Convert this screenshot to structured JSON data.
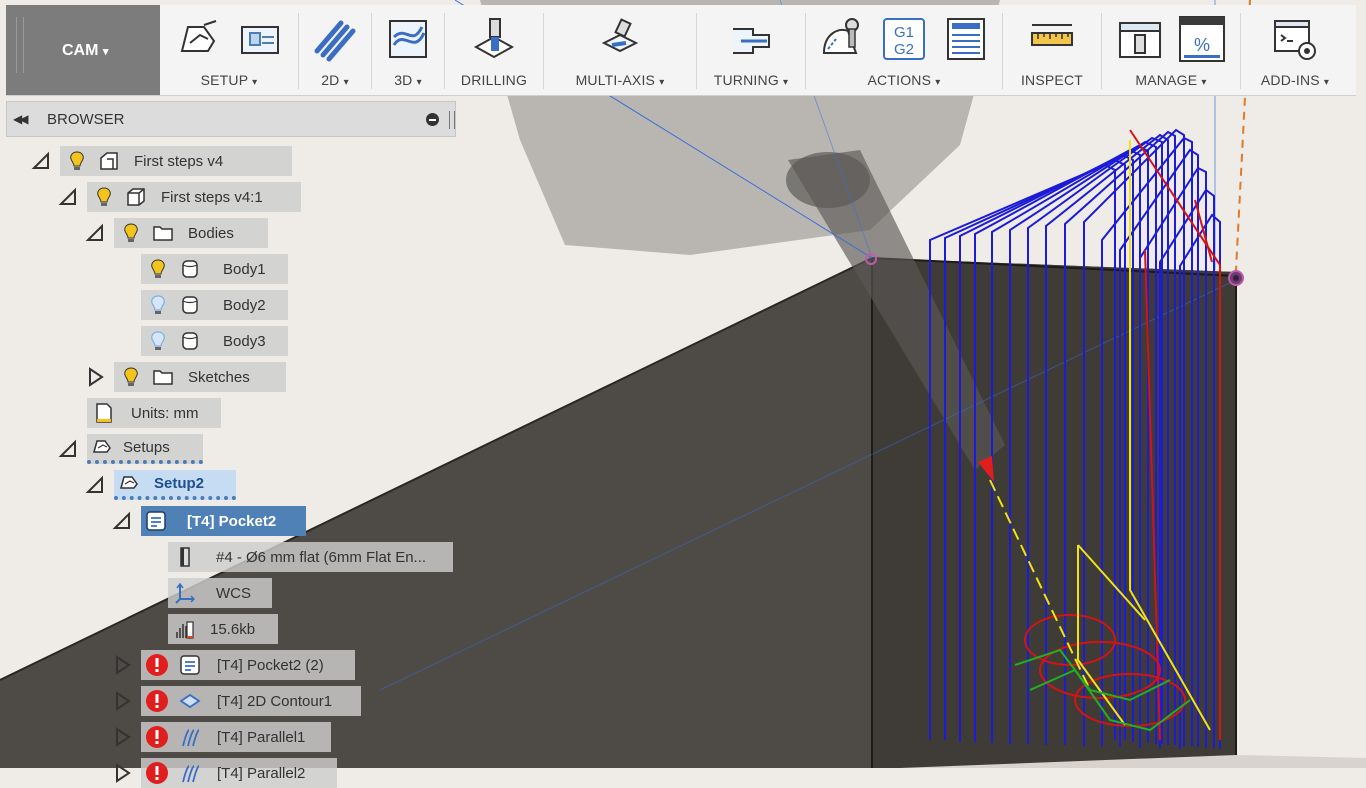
{
  "toolbar": {
    "workspace": "CAM",
    "groups": [
      {
        "label": "SETUP"
      },
      {
        "label": "2D"
      },
      {
        "label": "3D"
      },
      {
        "label": "DRILLING"
      },
      {
        "label": "MULTI-AXIS"
      },
      {
        "label": "TURNING"
      },
      {
        "label": "ACTIONS"
      },
      {
        "label": "INSPECT"
      },
      {
        "label": "MANAGE"
      },
      {
        "label": "ADD-INS"
      }
    ],
    "dropdown_glyph": "▾",
    "gcode_icon_text": "G1 G2",
    "percent_icon_text": "%"
  },
  "browser": {
    "title": "BROWSER",
    "tree": {
      "root": "First steps v4",
      "component": "First steps v4:1",
      "bodies_folder": "Bodies",
      "bodies": [
        "Body1",
        "Body2",
        "Body3"
      ],
      "sketches": "Sketches",
      "units": "Units: mm",
      "setups": "Setups",
      "setup": "Setup2",
      "operation": "[T4] Pocket2",
      "tool": "#4 - Ø6 mm flat (6mm Flat En...",
      "wcs": "WCS",
      "size": "15.6kb",
      "other_ops": [
        "[T4] Pocket2 (2)",
        "[T4] 2D Contour1",
        "[T4] Parallel1",
        "[T4] Parallel2"
      ]
    }
  },
  "colors": {
    "accent": "#4f80b6",
    "toolpath": "#1b1bd8",
    "error": "#e01e1e",
    "bulb_on": "#f2c41c",
    "bulb_off": "#7fb0e0"
  }
}
